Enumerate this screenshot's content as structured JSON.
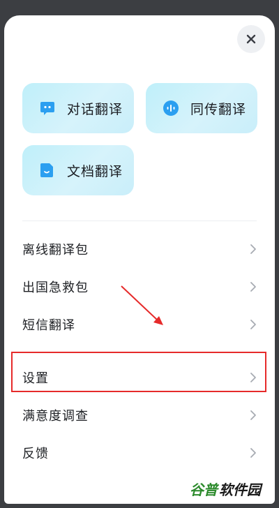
{
  "cards": [
    {
      "label": "对话翻译",
      "icon": "chat-bubble-icon"
    },
    {
      "label": "同传翻译",
      "icon": "voice-wave-icon"
    },
    {
      "label": "文档翻译",
      "icon": "document-icon"
    }
  ],
  "menu": {
    "items": [
      {
        "label": "离线翻译包"
      },
      {
        "label": "出国急救包"
      },
      {
        "label": "短信翻译"
      },
      {
        "label": "设置"
      },
      {
        "label": "满意度调查"
      },
      {
        "label": "反馈"
      }
    ]
  },
  "colors": {
    "card_bg": "#c9eefa",
    "icon_blue": "#2b9ff0",
    "annotation_red": "#e62a2a",
    "overlay": "#3c3e42"
  },
  "watermark": {
    "brand_a": "谷普",
    "brand_b": "软件园"
  }
}
